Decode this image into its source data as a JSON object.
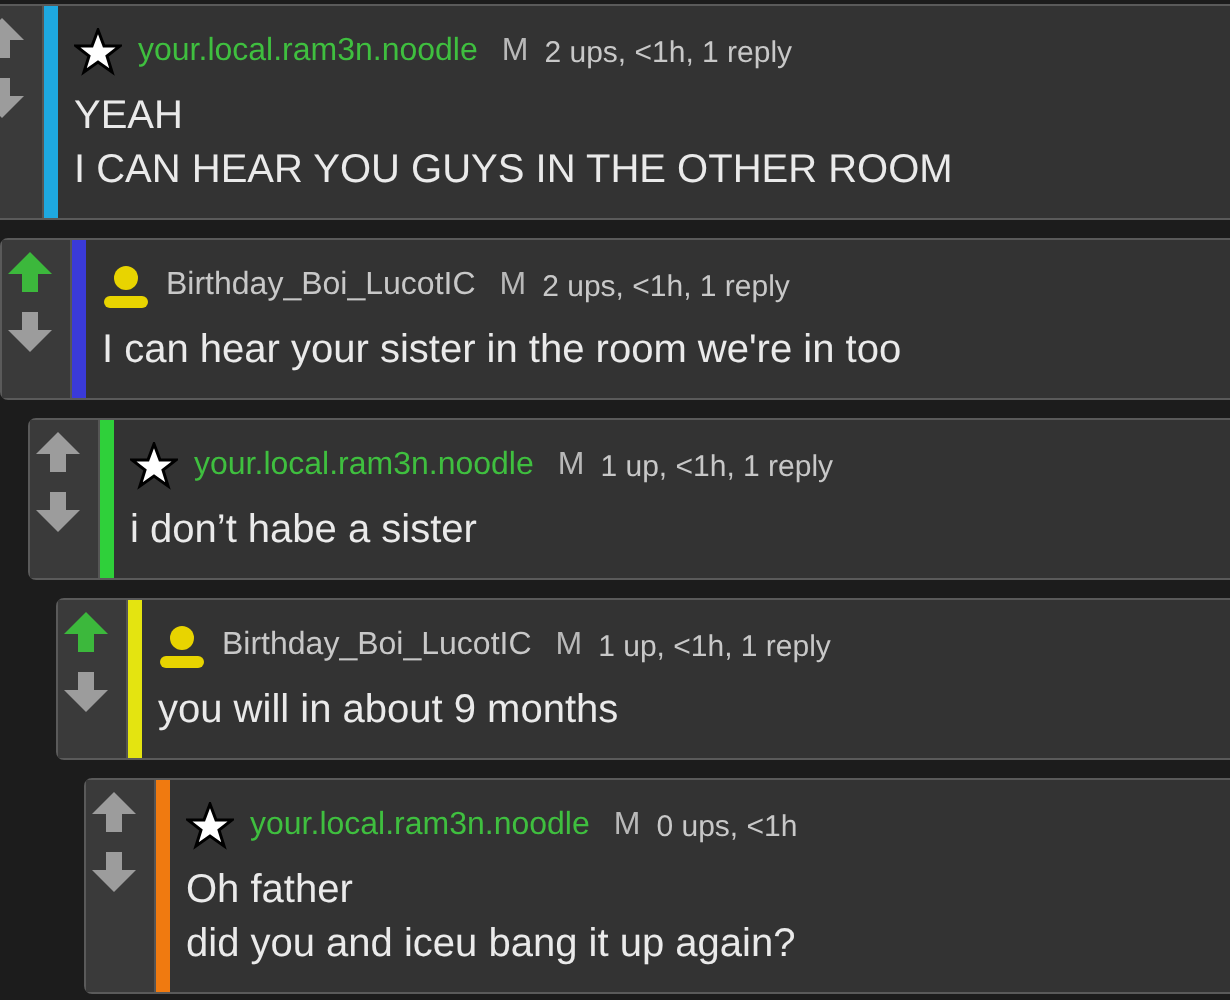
{
  "comments": [
    {
      "username": "your.local.ram3n.noodle",
      "kind": "star",
      "badge": "M",
      "meta": "2 ups, <1h, 1 reply",
      "color": "#1ea8e0",
      "upvoted": false,
      "lines": [
        "YEAH",
        "I CAN HEAR YOU GUYS IN THE OTHER ROOM"
      ],
      "children": [
        {
          "username": "Birthday_Boi_LucotIC",
          "kind": "person",
          "badge": "M",
          "meta": "2 ups, <1h, 1 reply",
          "color": "#3a3ad8",
          "upvoted": true,
          "lines": [
            "I can hear your sister in the room we're in too"
          ],
          "children": [
            {
              "username": "your.local.ram3n.noodle",
              "kind": "star",
              "badge": "M",
              "meta": "1 up, <1h, 1 reply",
              "color": "#2fd03a",
              "upvoted": false,
              "lines": [
                "i don’t habe a sister"
              ],
              "children": [
                {
                  "username": "Birthday_Boi_LucotIC",
                  "kind": "person",
                  "badge": "M",
                  "meta": "1 up, <1h, 1 reply",
                  "color": "#e4e410",
                  "upvoted": true,
                  "lines": [
                    "you will in about 9 months"
                  ],
                  "children": [
                    {
                      "username": "your.local.ram3n.noodle",
                      "kind": "star",
                      "badge": "M",
                      "meta": "0 ups, <1h",
                      "color": "#f07a10",
                      "upvoted": false,
                      "lines": [
                        "Oh father",
                        "did you and iceu bang it up again?"
                      ]
                    }
                  ]
                }
              ]
            }
          ]
        }
      ]
    }
  ]
}
